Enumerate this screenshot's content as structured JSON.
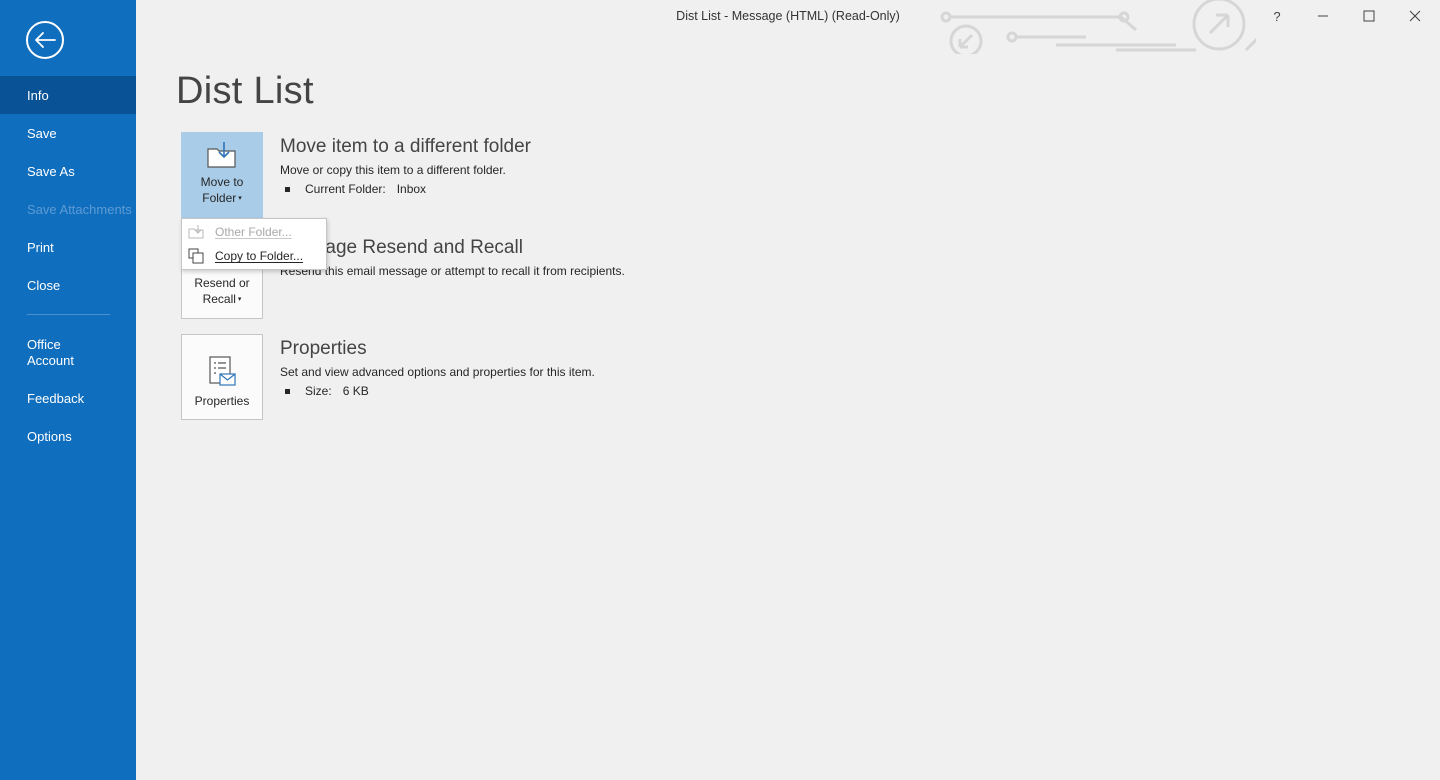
{
  "window": {
    "title": "Dist List  -  Message (HTML) (Read-Only)",
    "help_label": "?",
    "minimize_label": "—",
    "close_label": "✕"
  },
  "sidebar": {
    "items": [
      {
        "label": "Info"
      },
      {
        "label": "Save"
      },
      {
        "label": "Save As"
      },
      {
        "label": "Save Attachments"
      },
      {
        "label": "Print"
      },
      {
        "label": "Close"
      },
      {
        "label": "Office Account"
      },
      {
        "label": "Feedback"
      },
      {
        "label": "Options"
      }
    ]
  },
  "main": {
    "title": "Dist List",
    "sections": [
      {
        "button_line1": "Move to",
        "button_line2": "Folder",
        "title": "Move item to a different folder",
        "description": "Move or copy this item to a different folder.",
        "bullet_key": "Current Folder:",
        "bullet_value": "Inbox"
      },
      {
        "button_line1": "Resend or",
        "button_line2": "Recall",
        "title": "Message Resend and Recall",
        "description": "Resend this email message or attempt to recall it from recipients."
      },
      {
        "button_line1": "Properties",
        "title": "Properties",
        "description": "Set and view advanced options and properties for this item.",
        "bullet_key": "Size:",
        "bullet_value": "6 KB"
      }
    ],
    "dropdown": [
      {
        "label": "Other Folder..."
      },
      {
        "label": "Copy to Folder..."
      }
    ]
  },
  "colors": {
    "sidebar_bg": "#106ebe",
    "sidebar_active": "#0a5296",
    "selected_button": "#a9cde9"
  }
}
